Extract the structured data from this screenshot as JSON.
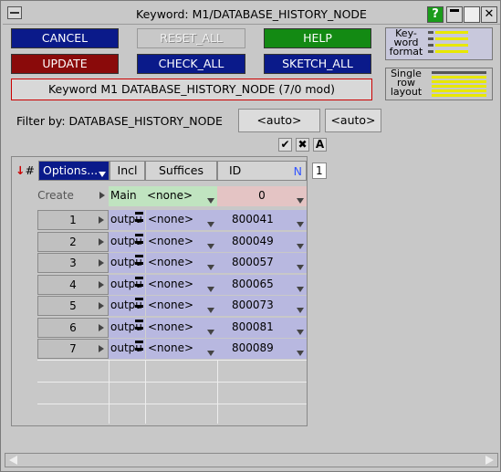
{
  "window": {
    "title": "Keyword: M1/DATABASE_HISTORY_NODE",
    "help_label": "?",
    "close_label": "✕"
  },
  "buttons": {
    "cancel": "CANCEL",
    "reset_all": "RESET_ALL",
    "help": "HELP",
    "update": "UPDATE",
    "check_all": "CHECK_ALL",
    "sketch_all": "SKETCH_ALL"
  },
  "keyword_status": "Keyword M1 DATABASE_HISTORY_NODE (7/0 mod)",
  "layout_options": {
    "keyword_format": [
      "Key-",
      "word",
      "format"
    ],
    "single_row": [
      "Single",
      "row",
      "layout"
    ]
  },
  "filter": {
    "label": "Filter by: DATABASE_HISTORY_NODE",
    "auto1": "<auto>",
    "auto2": "<auto>"
  },
  "table": {
    "sort_marker": "#",
    "headers": {
      "options": "Options...",
      "incl": "Incl",
      "suffices": "Suffices",
      "id": "ID",
      "n": "N"
    },
    "create_row": {
      "label": "Create",
      "incl": "Main",
      "suffices": "<none>",
      "id": "0"
    },
    "rows": [
      {
        "num": "1",
        "incl": "outpu",
        "suffices": "<none>",
        "id": "800041"
      },
      {
        "num": "2",
        "incl": "outpu",
        "suffices": "<none>",
        "id": "800049"
      },
      {
        "num": "3",
        "incl": "outpu",
        "suffices": "<none>",
        "id": "800057"
      },
      {
        "num": "4",
        "incl": "outpu",
        "suffices": "<none>",
        "id": "800065"
      },
      {
        "num": "5",
        "incl": "outpu",
        "suffices": "<none>",
        "id": "800073"
      },
      {
        "num": "6",
        "incl": "outpu",
        "suffices": "<none>",
        "id": "800081"
      },
      {
        "num": "7",
        "incl": "outpu",
        "suffices": "<none>",
        "id": "800089"
      }
    ],
    "page_number": "1"
  },
  "colors": {
    "blue_button": "#0a1a8a",
    "red_button": "#8a0a0a",
    "green_button": "#138a13",
    "row_fill": "#b8b8e0",
    "create_incl": "#c0e4c0",
    "create_id": "#e4c4c4"
  },
  "icons": {
    "check": "check-icon",
    "cross": "cross-icon",
    "text": "text-icon"
  }
}
